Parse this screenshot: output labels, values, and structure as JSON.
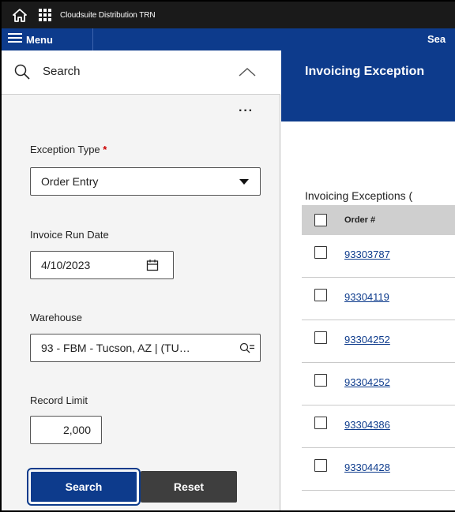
{
  "topbar": {
    "app_title": "Cloudsuite Distribution TRN"
  },
  "menubar": {
    "menu_label": "Menu",
    "page_tab": "Sea"
  },
  "search_panel": {
    "title": "Search",
    "more_label": "···",
    "exception_type": {
      "label": "Exception Type",
      "required_mark": "*",
      "value": "Order Entry"
    },
    "invoice_run_date": {
      "label": "Invoice Run Date",
      "value": "4/10/2023"
    },
    "warehouse": {
      "label": "Warehouse",
      "value": "93 - FBM - Tucson, AZ | (TU…"
    },
    "record_limit": {
      "label": "Record Limit",
      "value": "2,000"
    },
    "search_button": "Search",
    "reset_button": "Reset"
  },
  "content": {
    "title": "Invoicing Exception",
    "grid_caption": "Invoicing Exceptions (",
    "columns": [
      "Order #"
    ],
    "rows": [
      {
        "order": "93303787"
      },
      {
        "order": "93304119"
      },
      {
        "order": "93304252"
      },
      {
        "order": "93304252"
      },
      {
        "order": "93304386"
      },
      {
        "order": "93304428"
      }
    ]
  },
  "colors": {
    "brand_blue": "#0d3b8c",
    "topbar": "#1a1a1a",
    "reset_gray": "#3e3e3e"
  }
}
